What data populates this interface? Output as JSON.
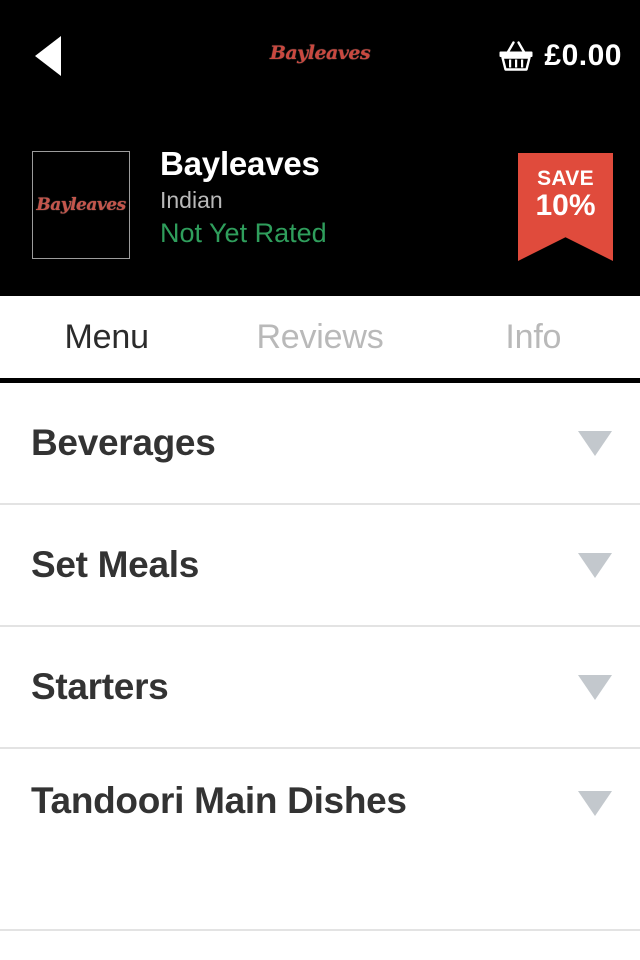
{
  "navbar": {
    "back_icon": "back-triangle-icon",
    "brand_logo_text": "Bayleaves",
    "basket_icon": "shopping-basket-icon",
    "basket_total": "£0.00"
  },
  "restaurant": {
    "thumbnail_logo_text": "Bayleaves",
    "name": "Bayleaves",
    "cuisine": "Indian",
    "rating": "Not Yet Rated",
    "badge": {
      "top_label": "SAVE",
      "amount": "10%",
      "color": "#e04b3c"
    }
  },
  "tabs": [
    {
      "label": "Menu",
      "active": true
    },
    {
      "label": "Reviews",
      "active": false
    },
    {
      "label": "Info",
      "active": false
    }
  ],
  "menu_categories": [
    {
      "label": "Beverages",
      "expand_icon": "chevron-down-icon"
    },
    {
      "label": "Set Meals",
      "expand_icon": "chevron-down-icon"
    },
    {
      "label": "Starters",
      "expand_icon": "chevron-down-icon"
    },
    {
      "label": "Tandoori Main Dishes",
      "expand_icon": "chevron-down-icon"
    }
  ],
  "colors": {
    "header_bg": "#000000",
    "brand_red": "#c9483f",
    "badge_red": "#e04b3c",
    "rating_green": "#2f9e5c",
    "tab_active": "#2b2b2b",
    "tab_inactive": "#b9b9b9",
    "category_text": "#333333",
    "chevron_gray": "#c3c8cd",
    "divider": "#e3e3e3"
  }
}
